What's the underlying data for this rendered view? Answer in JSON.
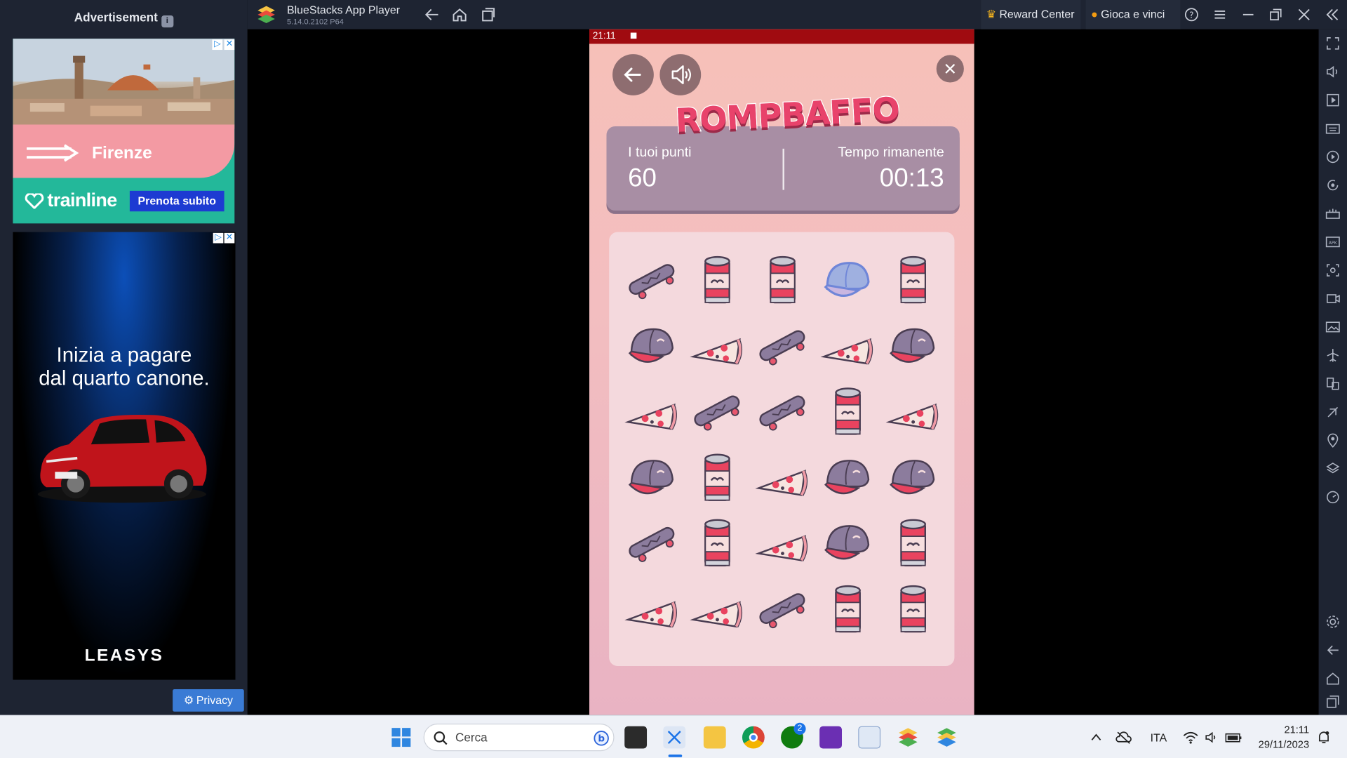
{
  "window": {
    "title": "BlueStacks App Player",
    "version": "5.14.0.2102  P64"
  },
  "titlebar": {
    "reward_label": "Reward Center",
    "gioca_label": "Gioca e vinci"
  },
  "ad_panel": {
    "label": "Advertisement",
    "ad1": {
      "city": "Firenze",
      "brand": "trainline",
      "cta": "Prenota subito"
    },
    "ad2": {
      "headline_1": "Inizia a pagare",
      "headline_2": "dal quarto canone.",
      "brand": "LEASYS"
    },
    "privacy_label": "Privacy"
  },
  "phone": {
    "status_time": "21:11"
  },
  "game": {
    "logo": "ROMPBAFFO",
    "score_label": "I tuoi punti",
    "score_value": "60",
    "time_label": "Tempo rimanente",
    "time_value": "00:13",
    "grid": [
      [
        "skateboard",
        "soda-can",
        "soda-can",
        "cap-selected",
        "soda-can"
      ],
      [
        "cap",
        "pizza",
        "skateboard",
        "pizza",
        "cap"
      ],
      [
        "pizza",
        "skateboard",
        "skateboard",
        "soda-can",
        "pizza"
      ],
      [
        "cap",
        "soda-can",
        "pizza",
        "cap",
        "cap"
      ],
      [
        "skateboard",
        "soda-can",
        "pizza",
        "cap",
        "soda-can"
      ],
      [
        "pizza",
        "pizza",
        "skateboard",
        "soda-can",
        "soda-can"
      ]
    ]
  },
  "taskbar": {
    "search_placeholder": "Cerca",
    "language": "ITA",
    "xbox_badge": "2",
    "clock_time": "21:11",
    "clock_date": "29/11/2023"
  }
}
